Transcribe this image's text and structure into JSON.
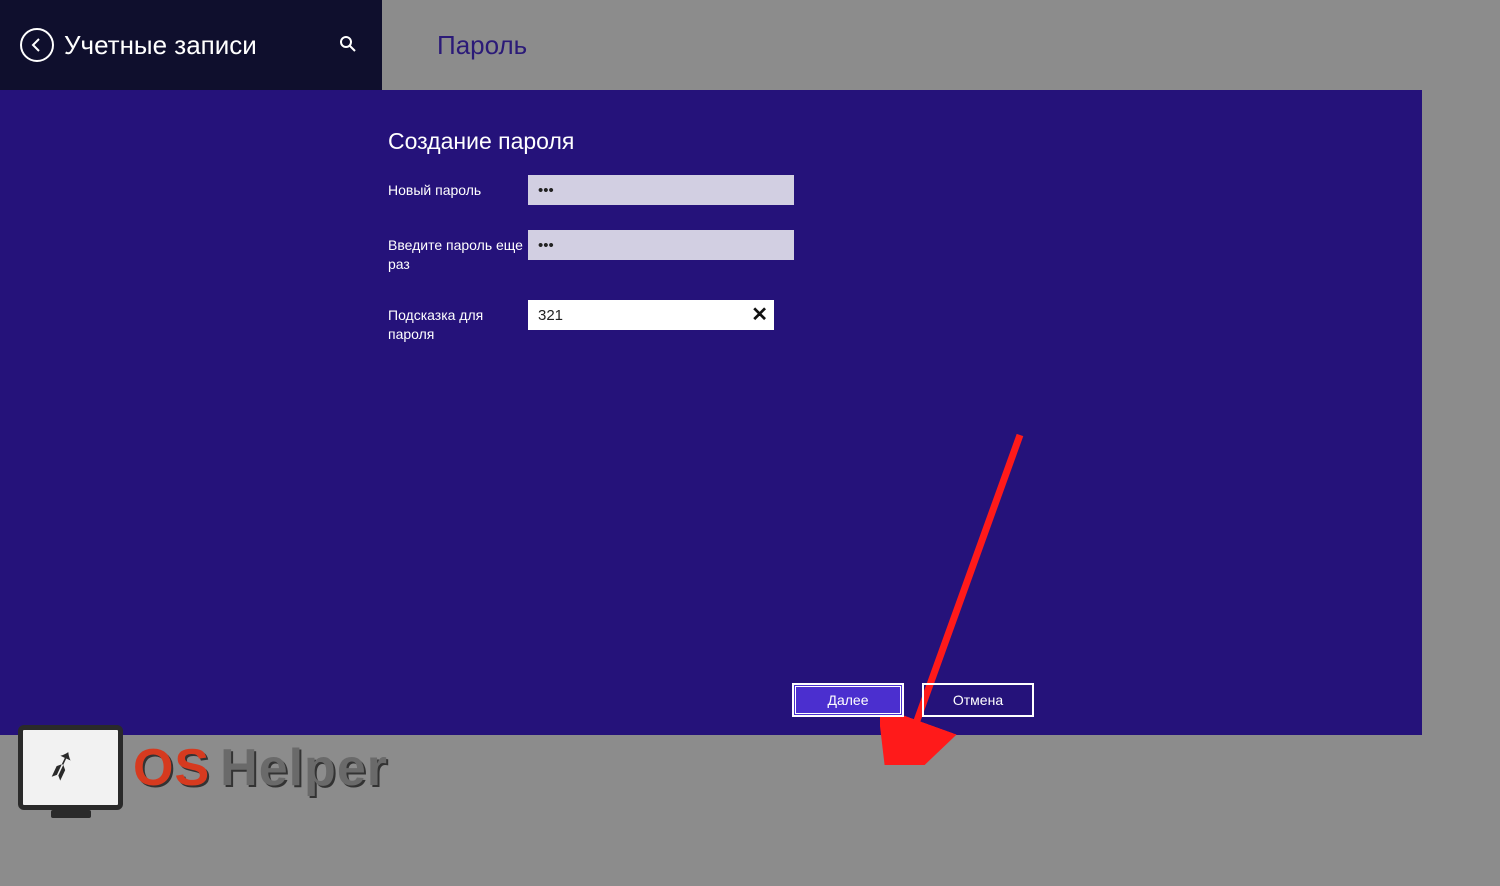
{
  "header": {
    "back_label": "Учетные записи",
    "section_title": "Пароль"
  },
  "form": {
    "title": "Создание пароля",
    "new_password_label": "Новый пароль",
    "new_password_value": "•••",
    "confirm_label": "Введите пароль еще раз",
    "confirm_value": "•••",
    "hint_label": "Подсказка для пароля",
    "hint_value": "321",
    "clear_symbol": "✕"
  },
  "buttons": {
    "next": "Далее",
    "cancel": "Отмена"
  },
  "watermark": {
    "os": "OS",
    "helper": "Helper"
  }
}
